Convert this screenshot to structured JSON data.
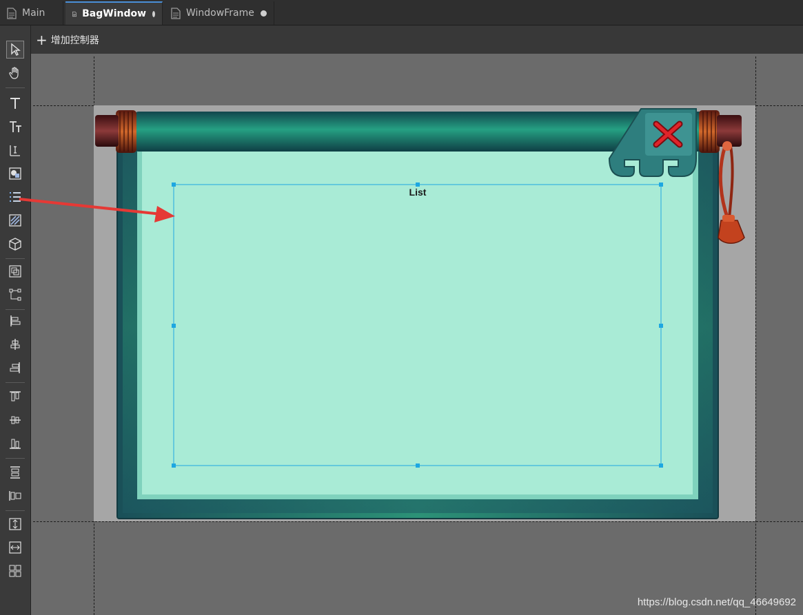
{
  "tabs": [
    {
      "label": "Main",
      "active": false,
      "modified": false
    },
    {
      "label": "BagWindow",
      "active": true,
      "modified": true
    },
    {
      "label": "WindowFrame",
      "active": false,
      "modified": true
    }
  ],
  "toolbar": {
    "add_controller_label": "增加控制器"
  },
  "tools": [
    {
      "name": "select-tool-icon"
    },
    {
      "name": "hand-tool-icon"
    },
    {
      "name": "text-tool-icon"
    },
    {
      "name": "rich-text-tool-icon"
    },
    {
      "name": "input-text-tool-icon"
    },
    {
      "name": "graph-tool-icon"
    },
    {
      "name": "list-tool-icon"
    },
    {
      "name": "image-tool-icon"
    },
    {
      "name": "component-3d-tool-icon"
    },
    {
      "name": "group-tool-icon"
    },
    {
      "name": "relation-tool-icon"
    },
    {
      "name": "align-left-icon"
    },
    {
      "name": "align-center-icon"
    },
    {
      "name": "align-right-icon"
    },
    {
      "name": "align-top-icon"
    },
    {
      "name": "align-middle-icon"
    },
    {
      "name": "align-bottom-icon"
    },
    {
      "name": "distribute-vertical-icon"
    },
    {
      "name": "distribute-horizontal-icon"
    },
    {
      "name": "same-height-icon"
    },
    {
      "name": "same-width-icon"
    },
    {
      "name": "grid-layout-icon"
    }
  ],
  "canvas": {
    "list_label": "List"
  },
  "watermark": "https://blog.csdn.net/qq_46649692",
  "colors": {
    "selection": "#1ea7e1",
    "frame_teal": "#237a6f",
    "panel_mint": "#a9ebd6",
    "arrow_red": "#e53935"
  }
}
